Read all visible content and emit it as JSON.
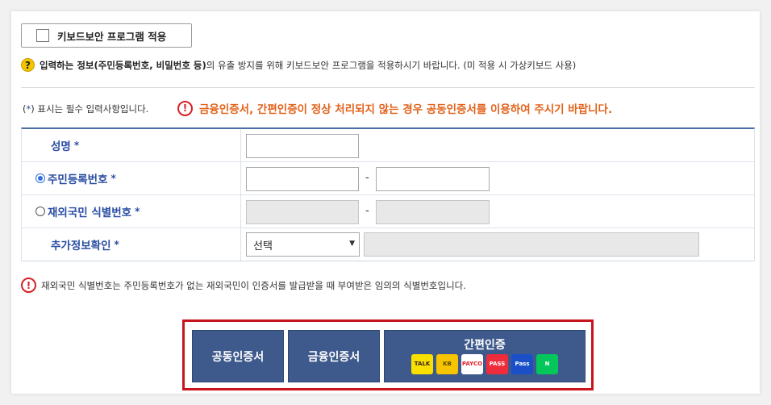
{
  "keyboard_security": {
    "label": "키보드보안 프로그램 적용"
  },
  "help": {
    "prefix": "입력하는 정보",
    "bold_part": "(주민등록번호, 비밀번호 등)",
    "suffix": "의 유출 방지를 위해 키보드보안 프로그램을 적용하시기 바랍니다. (미 적용 시 가상키보드 사용)"
  },
  "required_note": {
    "open": "(",
    "star": "*",
    "text": ") 표시는 필수 입력사항입니다."
  },
  "warning": "금융인증서, 간편인증이 정상 처리되지 않는 경우 공동인증서를 이용하여 주시기 바랍니다.",
  "form": {
    "name_label": "성명",
    "rrn_label": "주민등록번호",
    "foreign_label": "재외국민 식별번호",
    "extra_label": "추가정보확인",
    "required_mark": "*",
    "dash": "-",
    "name_value": "",
    "rrn_first": "",
    "rrn_second": "",
    "select_value": "선택",
    "select_arrow": "▼",
    "extra_value": ""
  },
  "foreign_notice": "재외국민 식별번호는 주민등록번호가 없는 재외국민이 인증서를 발급받을 때 부여받은 임의의 식별번호입니다.",
  "cert": {
    "joint": "공동인증서",
    "financial": "금융인증서",
    "simple": "간편인증",
    "logos": [
      {
        "text": "TALK",
        "bg": "#f9e000",
        "fg": "#3a1d1d",
        "name": "kakao-talk-icon"
      },
      {
        "text": "KB",
        "bg": "#f7c400",
        "fg": "#5a4a00",
        "name": "kb-icon"
      },
      {
        "text": "PAYCO",
        "bg": "#ffffff",
        "fg": "#e8202a",
        "name": "payco-icon"
      },
      {
        "text": "PASS",
        "bg": "#ee2c3c",
        "fg": "#ffffff",
        "name": "pass-icon"
      },
      {
        "text": "Pass",
        "bg": "#1a4fc8",
        "fg": "#ffffff",
        "name": "samsung-pass-icon"
      },
      {
        "text": "N",
        "bg": "#03c75a",
        "fg": "#ffffff",
        "name": "naver-icon"
      }
    ]
  },
  "colors": {
    "accent": "#3e5a8c",
    "highlight_border": "#c8141c",
    "warning": "#e2621b",
    "label": "#2b4ea3"
  }
}
